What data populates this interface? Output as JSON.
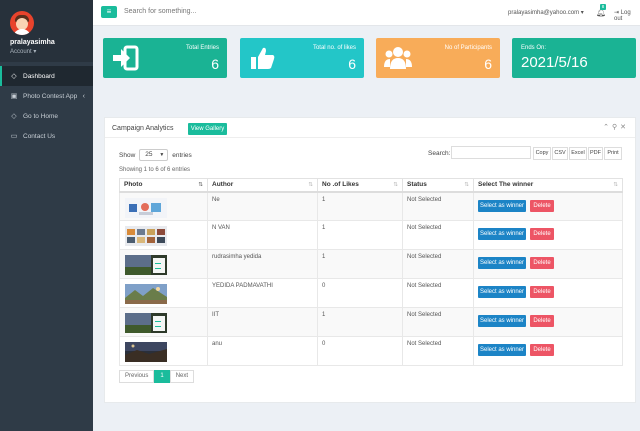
{
  "sidebar": {
    "user_name": "pralayasimha",
    "account_label": "Account ▾",
    "items": [
      {
        "label": "Dashboard",
        "icon": "diamond-icon"
      },
      {
        "label": "Photo Contest App",
        "icon": "image-icon"
      },
      {
        "label": "Go to Home",
        "icon": "diamond-icon"
      },
      {
        "label": "Contact Us",
        "icon": "laptop-icon"
      }
    ]
  },
  "topbar": {
    "search_placeholder": "Search for something...",
    "user_email": "pralayasimha@yahoo.com ▾",
    "notification_count": "8",
    "logout_label": "Log out"
  },
  "stats": {
    "total_entries": {
      "label": "Total Entries",
      "value": "6"
    },
    "total_likes": {
      "label": "Total no. of likes",
      "value": "6"
    },
    "participants": {
      "label": "No of Participants",
      "value": "6"
    },
    "ends_on": {
      "label": "Ends On:",
      "value": "2021/5/16"
    }
  },
  "panel": {
    "title": "Campaign Analytics",
    "gallery_button": "View Gallery",
    "show_label": "Show",
    "page_length": "25",
    "entries_label": "entries",
    "search_label": "Search:",
    "exports": [
      "Copy",
      "CSV",
      "Excel",
      "PDF",
      "Print"
    ],
    "showing_text": "Showing 1 to 6 of 6 entries",
    "columns": [
      "Photo",
      "Author",
      "No .of Likes",
      "Status",
      "Select The winner"
    ],
    "rows": [
      {
        "author": "Ne",
        "likes": "1",
        "status": "Not Selected"
      },
      {
        "author": "N VAN",
        "likes": "1",
        "status": "Not Selected"
      },
      {
        "author": "rudrasimha yedida",
        "likes": "1",
        "status": "Not Selected"
      },
      {
        "author": "YEDIDA PADMAVATHI",
        "likes": "0",
        "status": "Not Selected"
      },
      {
        "author": "IIT",
        "likes": "1",
        "status": "Not Selected"
      },
      {
        "author": "anu",
        "likes": "0",
        "status": "Not Selected"
      }
    ],
    "winner_button": "Select as winner",
    "delete_button": "Delete",
    "pager": {
      "previous": "Previous",
      "current": "1",
      "next": "Next"
    }
  },
  "colors": {
    "sidebar_bg": "#2f3b47",
    "accent": "#1abc9c",
    "cyan": "#23c6c8",
    "orange": "#f8ac59",
    "blue_button": "#1c84c6",
    "red_button": "#ed5565"
  }
}
